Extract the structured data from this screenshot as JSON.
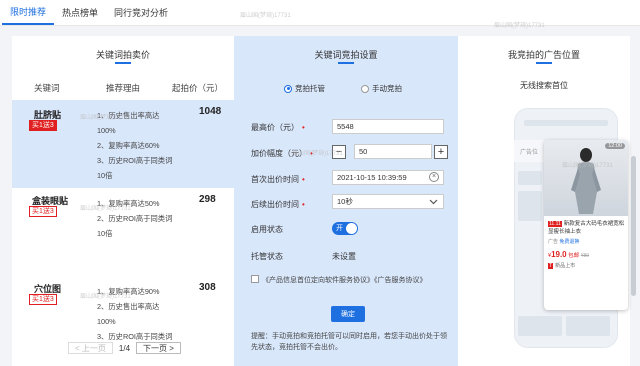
{
  "tabs": [
    {
      "label": "限时推荐",
      "active": true
    },
    {
      "label": "热点榜单",
      "active": false
    },
    {
      "label": "同行竞对分析",
      "active": false
    }
  ],
  "left_panel": {
    "title": "关键词拍卖价",
    "columns": [
      "关键词",
      "推荐理由",
      "起拍价（元）"
    ],
    "rows": [
      {
        "keyword": "肚脐贴",
        "badge": "买1送3",
        "price": "1048",
        "reasons": [
          "1、历史售出率高达",
          "100%",
          "2、复购率高达60%",
          "3、历史ROI高于同类词",
          "10倍"
        ]
      },
      {
        "keyword": "盒装眼贴",
        "badge": "买1送3",
        "price": "298",
        "reasons": [
          "1、复购率高达50%",
          "2、历史ROI高于同类词",
          "10倍"
        ]
      },
      {
        "keyword": "穴位图",
        "badge": "买1送3",
        "price": "308",
        "reasons": [
          "1、复购率高达90%",
          "2、历史售出率高达",
          "100%",
          "3、历史ROI高于同类词"
        ]
      }
    ],
    "pager": {
      "prev": "< 上一页",
      "info": "1/4",
      "next": "下一页 >"
    }
  },
  "mid_panel": {
    "title": "关键词竞拍设置",
    "radio_options": [
      {
        "label": "竞拍托管",
        "checked": true
      },
      {
        "label": "手动竞拍",
        "checked": false
      }
    ],
    "max_price_label": "最高价（元）",
    "max_price_value": "5548",
    "increment_label": "加价幅度（元）",
    "increment_value": "50",
    "first_bid_label": "首次出价时间",
    "first_bid_value": "2021-10-15 10:39:59",
    "later_bid_label": "后续出价时间",
    "later_bid_value": "10秒",
    "enable_label": "启用状态",
    "enable_value": "开",
    "hosting_label": "托管状态",
    "hosting_value": "未设置",
    "agreement": "《产品信息首位定向软件服务协议》《广告服务协议》",
    "confirm": "确定",
    "hint": "提醒：手动竞拍和竞拍托管可以同时启用，若您手动出价处于领先状态，竞拍托管不会出价。"
  },
  "right_panel": {
    "title": "我竞拍的广告位置",
    "subtitle": "无线搜索首位",
    "ad": {
      "timer": "12:00",
      "tag": "11.11",
      "title": "新款复古大码毛衣裙宽松显瘦长袖上衣",
      "sub_prefix": "广告",
      "sub_highlight": "免费退换",
      "price_prefix": "¥",
      "price": "19.0",
      "price_unit": "包邮",
      "orig_price": "¥89",
      "seller_tag": "T",
      "seller": "新品上市",
      "logo_line1": "广告位",
      "logo_line2": "广告"
    }
  },
  "watermark": "眉山国(梦琦)17731"
}
